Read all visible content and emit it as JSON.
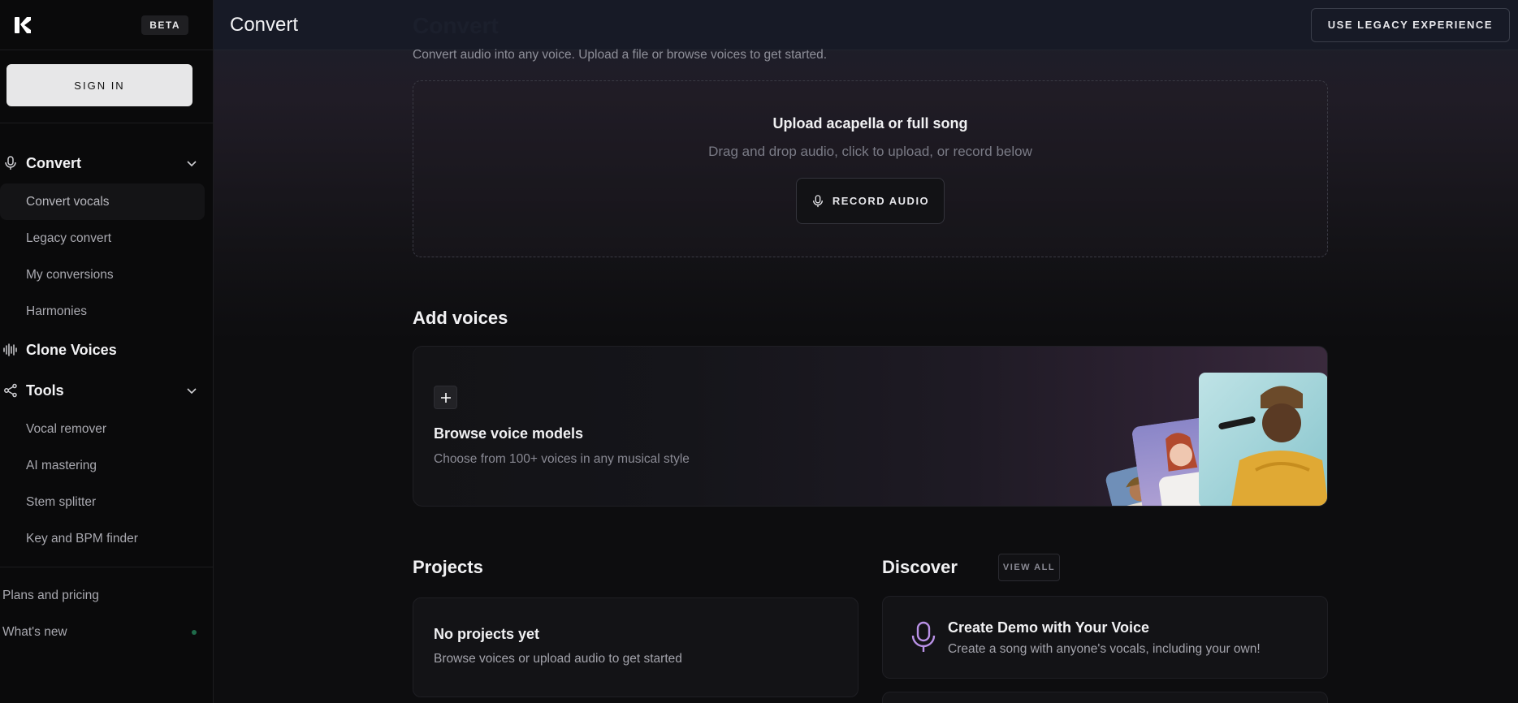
{
  "sidebar": {
    "beta_label": "BETA",
    "sign_in_label": "SIGN IN",
    "sections": {
      "convert": {
        "label": "Convert",
        "items": [
          "Convert vocals",
          "Legacy convert",
          "My conversions",
          "Harmonies"
        ]
      },
      "clone": {
        "label": "Clone Voices"
      },
      "tools": {
        "label": "Tools",
        "items": [
          "Vocal remover",
          "AI mastering",
          "Stem splitter",
          "Key and BPM finder"
        ]
      }
    },
    "bottom": {
      "plans": "Plans and pricing",
      "whats_new": "What's new"
    }
  },
  "header": {
    "title": "Convert",
    "legacy_label": "USE LEGACY EXPERIENCE"
  },
  "main": {
    "subtitle": "Convert audio into any voice. Upload a file or browse voices to get started.",
    "upload": {
      "title": "Upload acapella or full song",
      "subtitle": "Drag and drop audio, click to upload, or record below",
      "record_label": "RECORD AUDIO"
    },
    "add_voices": {
      "title": "Add voices",
      "browse_title": "Browse voice models",
      "browse_subtitle": "Choose from 100+ voices in any musical style"
    },
    "projects": {
      "title": "Projects",
      "view_all_label": "VIEW ALL",
      "empty_title": "No projects yet",
      "empty_subtitle": "Browse voices or upload audio to get started"
    },
    "discover": {
      "title": "Discover",
      "card_title": "Create Demo with Your Voice",
      "card_subtitle": "Create a song with anyone's vocals, including your own!"
    }
  },
  "colors": {
    "accent_mic": "#b991e6",
    "status_dot": "#1f6b4a"
  },
  "icons": {
    "logo": "brand-logo-icon",
    "mic": "microphone-icon",
    "waveform": "waveform-icon",
    "tools": "share-nodes-icon",
    "chevron": "chevron-down-icon",
    "plus": "plus-icon"
  }
}
